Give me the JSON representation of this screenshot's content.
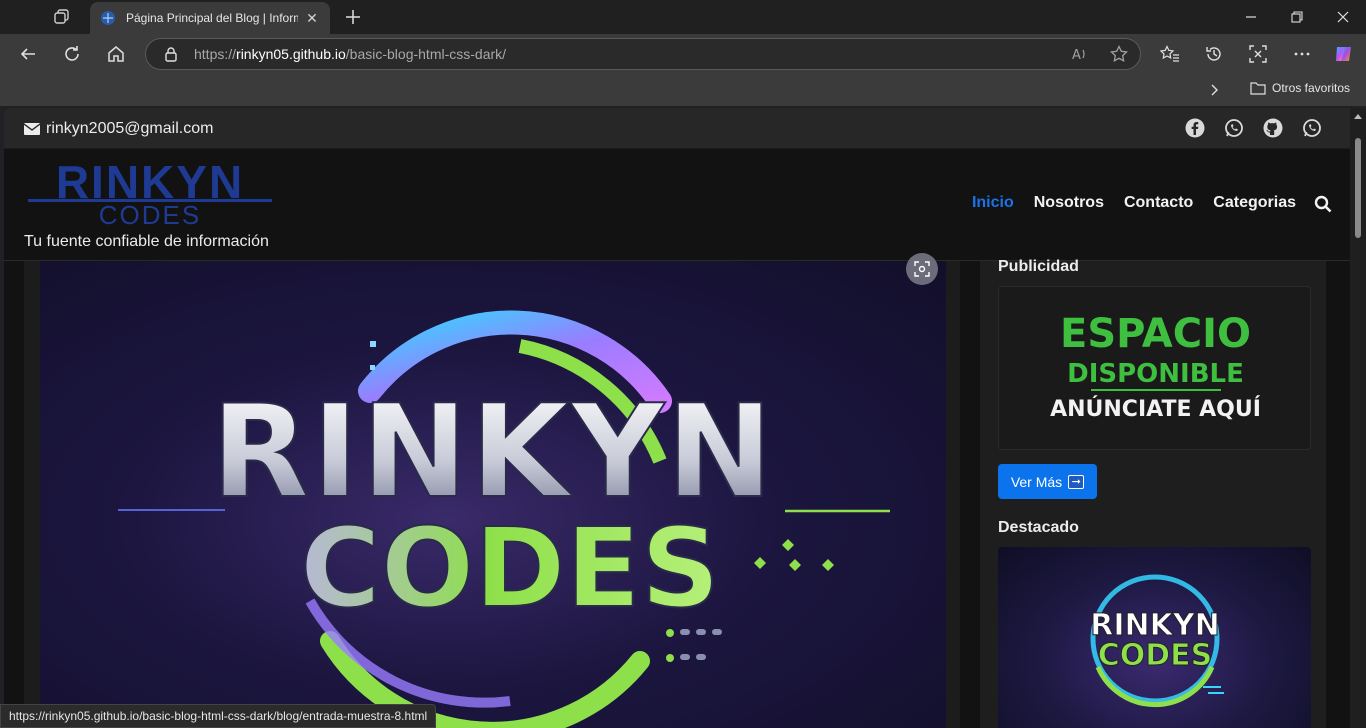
{
  "browser": {
    "tab_title": "Página Principal del Blog | Informa",
    "url_prefix": "https://",
    "url_host": "rinkyn05.github.io",
    "url_path": "/basic-blog-html-css-dark/",
    "favorites_folder": "Otros favoritos",
    "status_url": "https://rinkyn05.github.io/basic-blog-html-css-dark/blog/entrada-muestra-8.html"
  },
  "site": {
    "email": "rinkyn2005@gmail.com",
    "logo_main": "RINKYN",
    "logo_sub": "CODES",
    "tagline": "Tu fuente confiable de información",
    "nav": [
      "Inicio",
      "Nosotros",
      "Contacto",
      "Categorias"
    ],
    "social_icons": [
      "facebook-icon",
      "whatsapp-icon",
      "github-icon",
      "whatsapp-icon"
    ]
  },
  "hero": {
    "line1": "RINKYN",
    "line2": "CODES"
  },
  "sidebar": {
    "ad_title": "Publicidad",
    "ad_line1": "ESPACIO",
    "ad_line2": "DISPONIBLE",
    "ad_line3": "ANÚNCIATE AQUÍ",
    "ver_mas": "Ver Más",
    "featured_title": "Destacado",
    "featured_line1": "RINKYN",
    "featured_line2": "CODES"
  },
  "colors": {
    "accent": "#1a73e8",
    "brand_blue": "#1f3a93",
    "ad_green": "#3fbf3f",
    "hero_green": "#8ee04a"
  }
}
